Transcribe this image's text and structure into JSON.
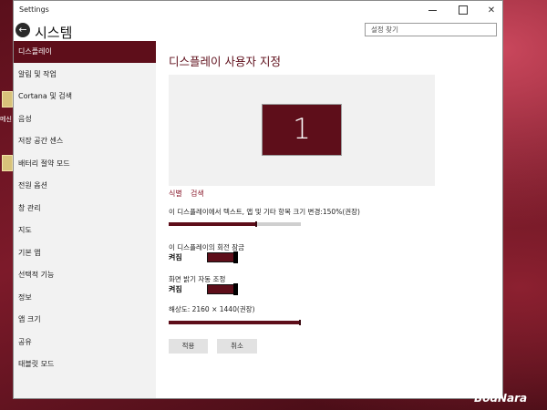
{
  "desktop": {
    "icon_label": "메신"
  },
  "window": {
    "app_title": "Settings",
    "controls": {
      "minimize_icon": "minimize-icon",
      "maximize_icon": "maximize-icon",
      "close_glyph": "✕"
    }
  },
  "header": {
    "back_glyph": "←",
    "section_title": "시스템",
    "search_placeholder": "설정 찾기"
  },
  "sidebar": {
    "items": [
      {
        "label": "디스플레이",
        "active": true
      },
      {
        "label": "알림 및 작업"
      },
      {
        "label": "Cortana 및 검색"
      },
      {
        "label": "음성"
      },
      {
        "label": "저장 공간 센스"
      },
      {
        "label": "배터리 절약 모드"
      },
      {
        "label": "전원 옵션"
      },
      {
        "label": "창 관리"
      },
      {
        "label": "지도"
      },
      {
        "label": "기본 앱"
      },
      {
        "label": "선택적 기능"
      },
      {
        "label": "정보"
      },
      {
        "label": "앱 크기"
      },
      {
        "label": "공유"
      },
      {
        "label": "태블릿 모드"
      }
    ]
  },
  "main": {
    "page_title": "디스플레이 사용자 지정",
    "monitor_number": "1",
    "identify_link": "식별",
    "detect_link": "검색",
    "scale_label": "이 디스플레이에서 텍스트, 앱 및 기타 항목 크기 변경:150%(권장)",
    "scale_fraction": 0.67,
    "rotation_lock": {
      "label": "이 디스플레이의 회전 잠금",
      "state": "켜짐",
      "on": true
    },
    "auto_brightness": {
      "label": "화면 밝기 자동 조정",
      "state": "켜짐",
      "on": true
    },
    "resolution_label": "해상도: 2160 × 1440(권장)",
    "resolution_fraction": 1.0,
    "apply_button": "적용",
    "cancel_button": "취소"
  },
  "watermark": "BodNara",
  "colors": {
    "accent": "#5e0e1a",
    "link": "#8a1a2c",
    "sidebar_bg": "#f2f2f2"
  }
}
